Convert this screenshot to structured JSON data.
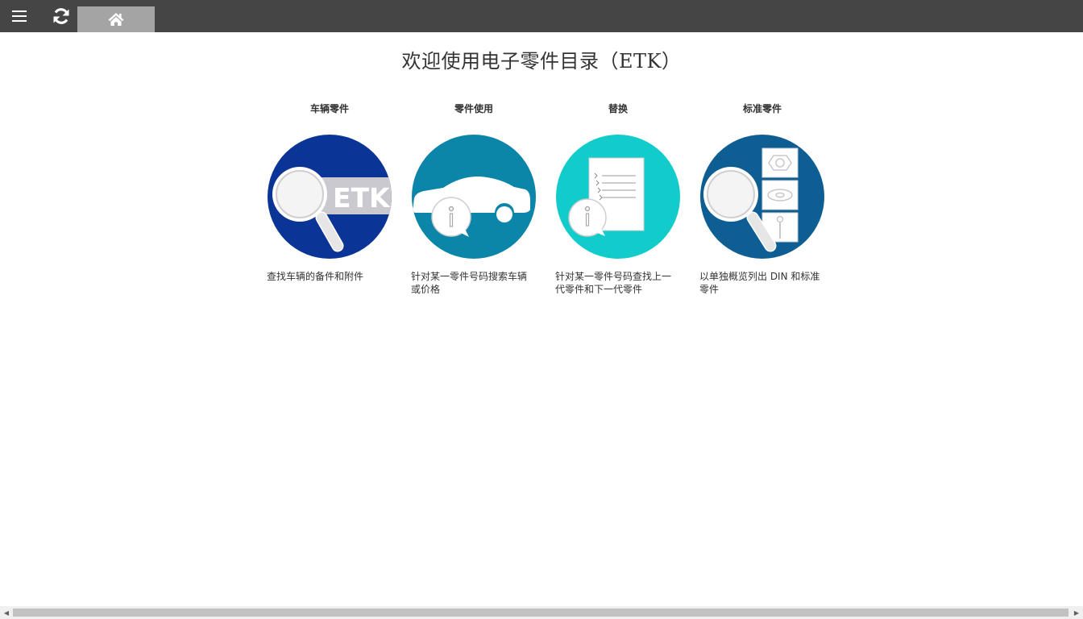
{
  "page": {
    "title": "欢迎使用电子零件目录（ETK）"
  },
  "toolbar": {
    "menu_icon": "hamburger-menu-icon",
    "refresh_icon": "refresh-icon",
    "home_icon": "home-icon"
  },
  "tiles": [
    {
      "heading": "车辆零件",
      "description": "查找车辆的备件和附件",
      "icon": "magnifier-etk-icon",
      "icon_label": "ETK",
      "color": "#0a3496"
    },
    {
      "heading": "零件使用",
      "description": "针对某一零件号码搜索车辆或价格",
      "icon": "car-info-icon",
      "color": "#0b85a8"
    },
    {
      "heading": "替换",
      "description": "针对某一零件号码查找上一代零件和下一代零件",
      "icon": "document-info-icon",
      "color": "#12cccb"
    },
    {
      "heading": "标准零件",
      "description": "以单独概览列出 DIN 和标准零件",
      "icon": "magnifier-standard-parts-icon",
      "color": "#0e5e94"
    }
  ],
  "colors": {
    "topbar": "#454545",
    "home_tab": "#a4a4a4"
  }
}
